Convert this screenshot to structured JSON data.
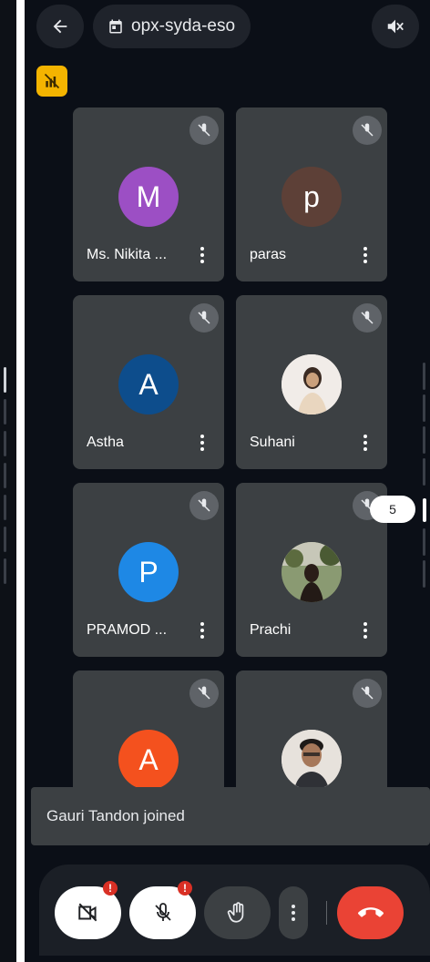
{
  "header": {
    "back_icon": "arrow-back-icon",
    "calendar_icon": "calendar-icon",
    "meeting_code": "opx-syda-eso",
    "speaker_icon": "speaker-muted-icon"
  },
  "participants": [
    {
      "name": "Ms. Nikita ...",
      "initial": "M",
      "color": "#9c4fc4",
      "muted": true
    },
    {
      "name": "paras",
      "initial": "p",
      "color": "#5d4037",
      "muted": true
    },
    {
      "name": "Astha",
      "initial": "A",
      "color": "#0d4d8c",
      "muted": true
    },
    {
      "name": "Suhani",
      "initial": "",
      "photo": "photo-avatar",
      "muted": true
    },
    {
      "name": "PRAMOD ...",
      "initial": "P",
      "color": "#1e88e5",
      "muted": true
    },
    {
      "name": "Prachi",
      "initial": "",
      "photo": "photo-avatar",
      "muted": true
    },
    {
      "name": "",
      "initial": "A",
      "color": "#f4511e",
      "muted": true
    },
    {
      "name": "",
      "initial": "",
      "photo": "photo-avatar",
      "muted": true
    }
  ],
  "page_indicator": "5",
  "toast": {
    "text": "Gauri Tandon joined"
  },
  "controls": {
    "camera": "camera-off-icon",
    "mic": "mic-off-icon",
    "alert_mark": "!",
    "raise_hand": "hand-icon",
    "more": "more-vert-icon",
    "end_call": "call-end-icon"
  },
  "colors": {
    "background": "#0b0f17",
    "tile": "#3c4043",
    "end_call": "#ea4335",
    "badge_yellow": "#f4b400"
  }
}
